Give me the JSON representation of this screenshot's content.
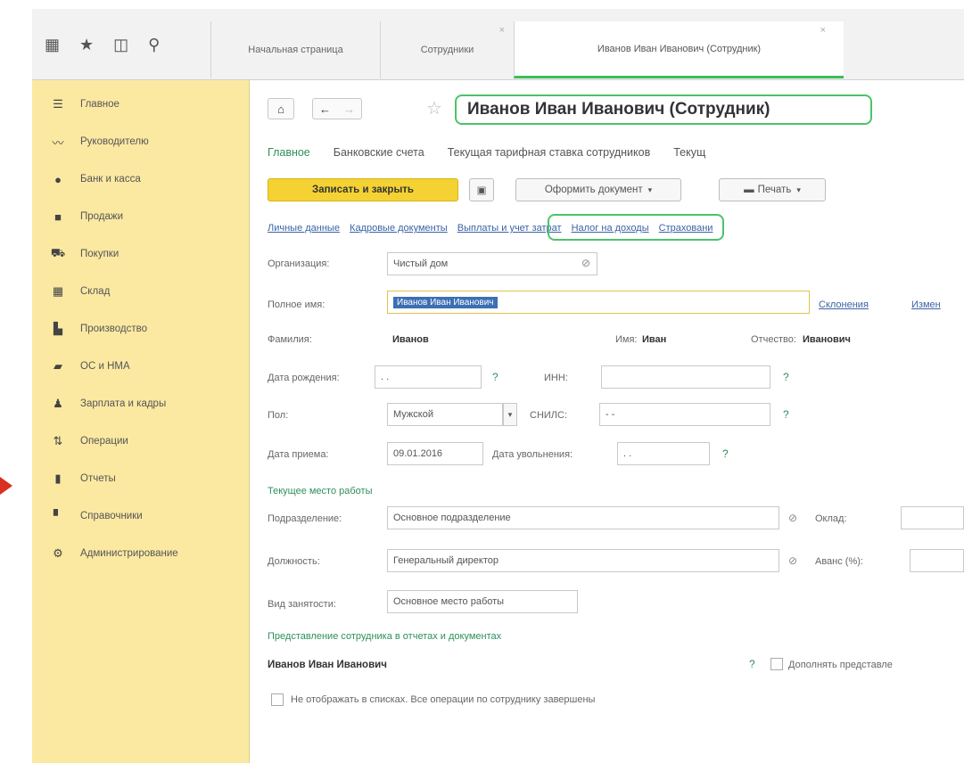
{
  "tabs": [
    {
      "label": "Начальная страница"
    },
    {
      "label": "Сотрудники"
    },
    {
      "label": "Иванов Иван Иванович (Сотрудник)"
    }
  ],
  "sidebar": {
    "items": [
      {
        "label": "Главное",
        "icon": "menu-icon"
      },
      {
        "label": "Руководителю",
        "icon": "chart-line-icon"
      },
      {
        "label": "Банк и касса",
        "icon": "coin-icon"
      },
      {
        "label": "Продажи",
        "icon": "shopping-bag-icon"
      },
      {
        "label": "Покупки",
        "icon": "cart-icon"
      },
      {
        "label": "Склад",
        "icon": "warehouse-icon"
      },
      {
        "label": "Производство",
        "icon": "factory-icon"
      },
      {
        "label": "ОС и НМА",
        "icon": "truck-icon"
      },
      {
        "label": "Зарплата и кадры",
        "icon": "person-icon"
      },
      {
        "label": "Операции",
        "icon": "operations-icon"
      },
      {
        "label": "Отчеты",
        "icon": "bar-chart-icon"
      },
      {
        "label": "Справочники",
        "icon": "book-icon"
      },
      {
        "label": "Администрирование",
        "icon": "gear-icon"
      }
    ]
  },
  "form": {
    "title": "Иванов Иван Иванович (Сотрудник)",
    "subtabs": [
      "Главное",
      "Банковские счета",
      "Текущая тарифная ставка сотрудников",
      "Текущ"
    ],
    "toolbar": {
      "save_close": "Записать и закрыть",
      "create_doc": "Оформить документ",
      "print": "Печать"
    },
    "links": [
      "Личные данные",
      "Кадровые документы",
      "Выплаты и учет затрат",
      "Налог на доходы",
      "Страховани"
    ],
    "organization": {
      "label": "Организация:",
      "value": "Чистый дом"
    },
    "full_name": {
      "label": "Полное имя:",
      "value": "Иванов Иван Иванович",
      "declension": "Склонения",
      "change": "Измен"
    },
    "surname": {
      "label": "Фамилия:",
      "value": "Иванов"
    },
    "name": {
      "label": "Имя:",
      "value": "Иван"
    },
    "patronymic": {
      "label": "Отчество:",
      "value": "Иванович"
    },
    "birth_date": {
      "label": "Дата рождения:",
      "value": " .  .   "
    },
    "inn": {
      "label": "ИНН:",
      "value": ""
    },
    "gender": {
      "label": "Пол:",
      "value": "Мужской"
    },
    "snils": {
      "label": "СНИЛС:",
      "value": " -   -  "
    },
    "hire_date": {
      "label": "Дата приема:",
      "value": "09.01.2016"
    },
    "dismissal_date": {
      "label": "Дата увольнения:",
      "value": " .  .   "
    },
    "current_workplace": "Текущее место работы",
    "department": {
      "label": "Подразделение:",
      "value": "Основное подразделение"
    },
    "salary": {
      "label": "Оклад:"
    },
    "position": {
      "label": "Должность:",
      "value": "Генеральный директор"
    },
    "advance": {
      "label": "Аванс (%):"
    },
    "employment_type": {
      "label": "Вид занятости:",
      "value": "Основное место работы"
    },
    "representation_section": "Представление сотрудника в отчетах и документах",
    "representation_name": "Иванов Иван Иванович",
    "supplement": "Дополнять представле",
    "hide_option": "Не отображать в списках. Все операции по сотруднику завершены",
    "help": "?"
  }
}
